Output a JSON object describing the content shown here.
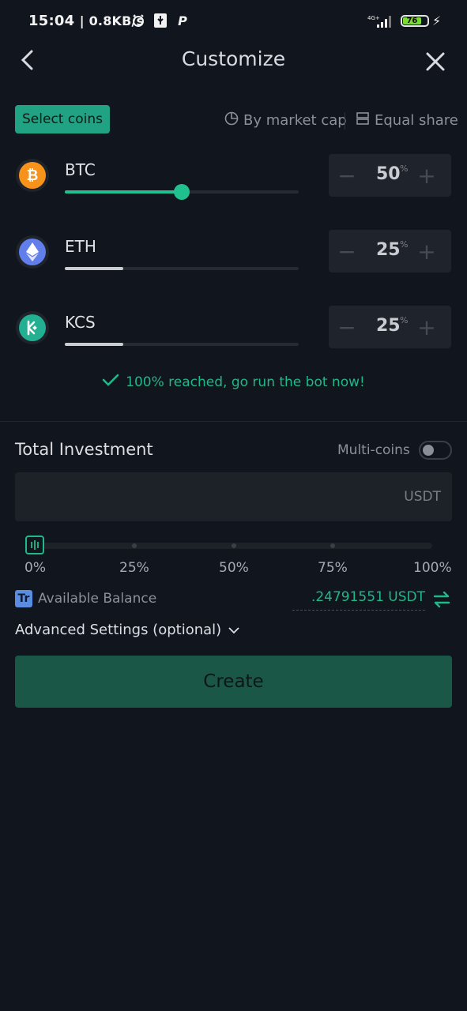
{
  "status_bar": {
    "time": "15:04",
    "speed": "| 0.8KB/s",
    "network": "4G+",
    "battery": "76"
  },
  "header": {
    "title": "Customize"
  },
  "tabs": {
    "select_coins": "Select coins",
    "by_market_cap": "By market cap",
    "equal_share": "Equal share"
  },
  "coins": [
    {
      "symbol": "BTC",
      "percent": "50",
      "unit": "%",
      "slider_fraction": 0.5,
      "color": "#f7931a",
      "track_color": "#21c18f"
    },
    {
      "symbol": "ETH",
      "percent": "25",
      "unit": "%",
      "slider_fraction": 0.25,
      "color": "#627eea",
      "track_color": "#c9ccd1"
    },
    {
      "symbol": "KCS",
      "percent": "25",
      "unit": "%",
      "slider_fraction": 0.25,
      "color": "#23af91",
      "track_color": "#c9ccd1"
    }
  ],
  "reached_message": "100% reached, go run the bot now!",
  "investment": {
    "label": "Total Investment",
    "multi_coins_label": "Multi-coins",
    "multi_coins_on": false,
    "unit": "USDT",
    "percent_labels": [
      "0%",
      "25%",
      "50%",
      "75%",
      "100%"
    ],
    "available_label": "Available Balance",
    "available_badge": "Tr",
    "available_value": ".24791551 USDT"
  },
  "advanced_settings": "Advanced Settings (optional)",
  "create_button": "Create",
  "colors": {
    "accent": "#21c18f",
    "background": "#11151d"
  }
}
